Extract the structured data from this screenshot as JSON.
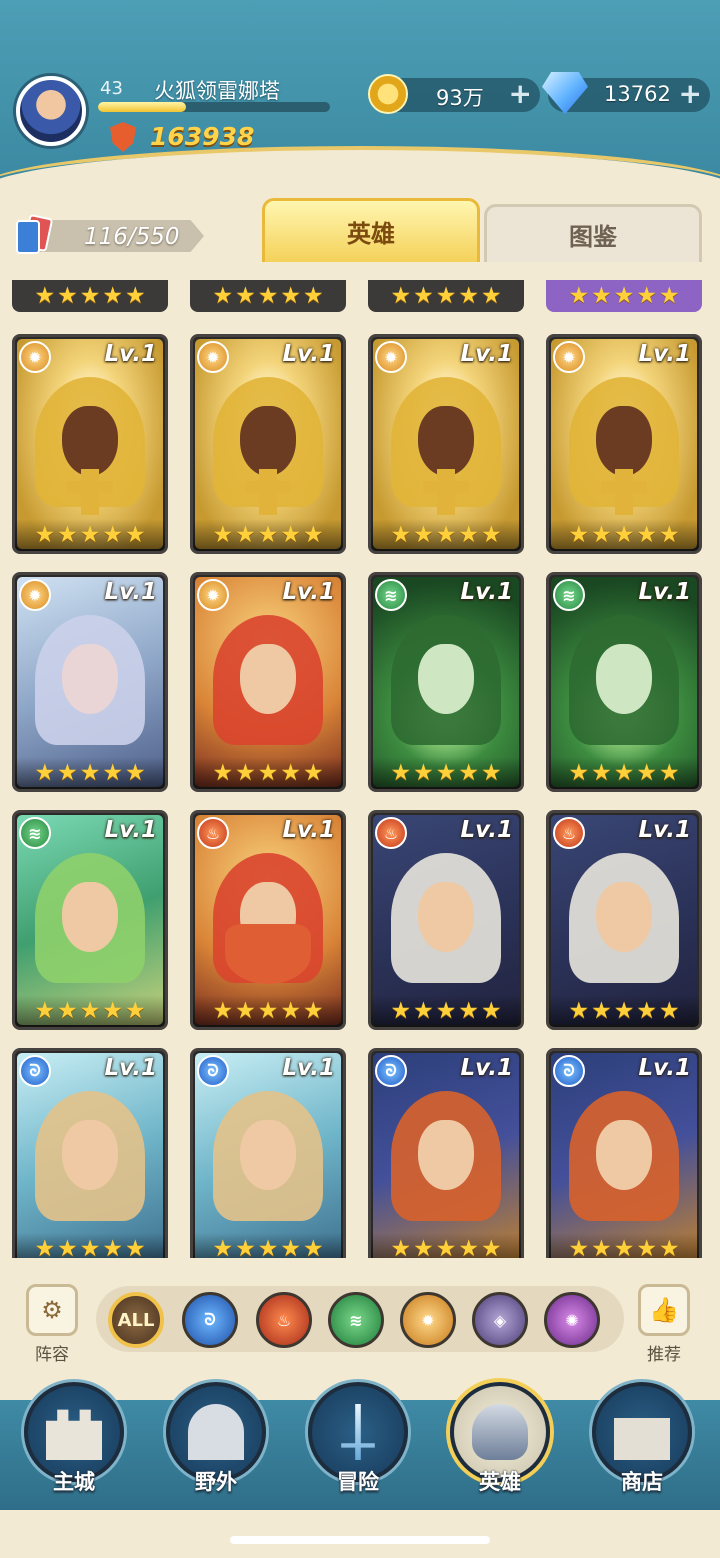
{
  "player": {
    "level": "43",
    "name": "火狐领雷娜塔",
    "level_progress": 0.38,
    "power": "163938"
  },
  "resources": {
    "gold": "93万",
    "gems": "13762",
    "plus": "+"
  },
  "collection": {
    "count": "116/550"
  },
  "tabs": {
    "heroes": "英雄",
    "gallery": "图鉴"
  },
  "hero_level_label": "Lv.1",
  "star_glyph": "★",
  "filters": {
    "all": "ALL",
    "lineup": "阵容",
    "recommend": "推荐"
  },
  "nav": {
    "main_city": "主城",
    "wild": "野外",
    "adventure": "冒险",
    "heroes": "英雄",
    "shop": "商店"
  },
  "colors": {
    "header": "#4d9fb6",
    "accent_gold": "#f4d15a",
    "star": "#ffd03a",
    "panel": "#f3ead3"
  }
}
